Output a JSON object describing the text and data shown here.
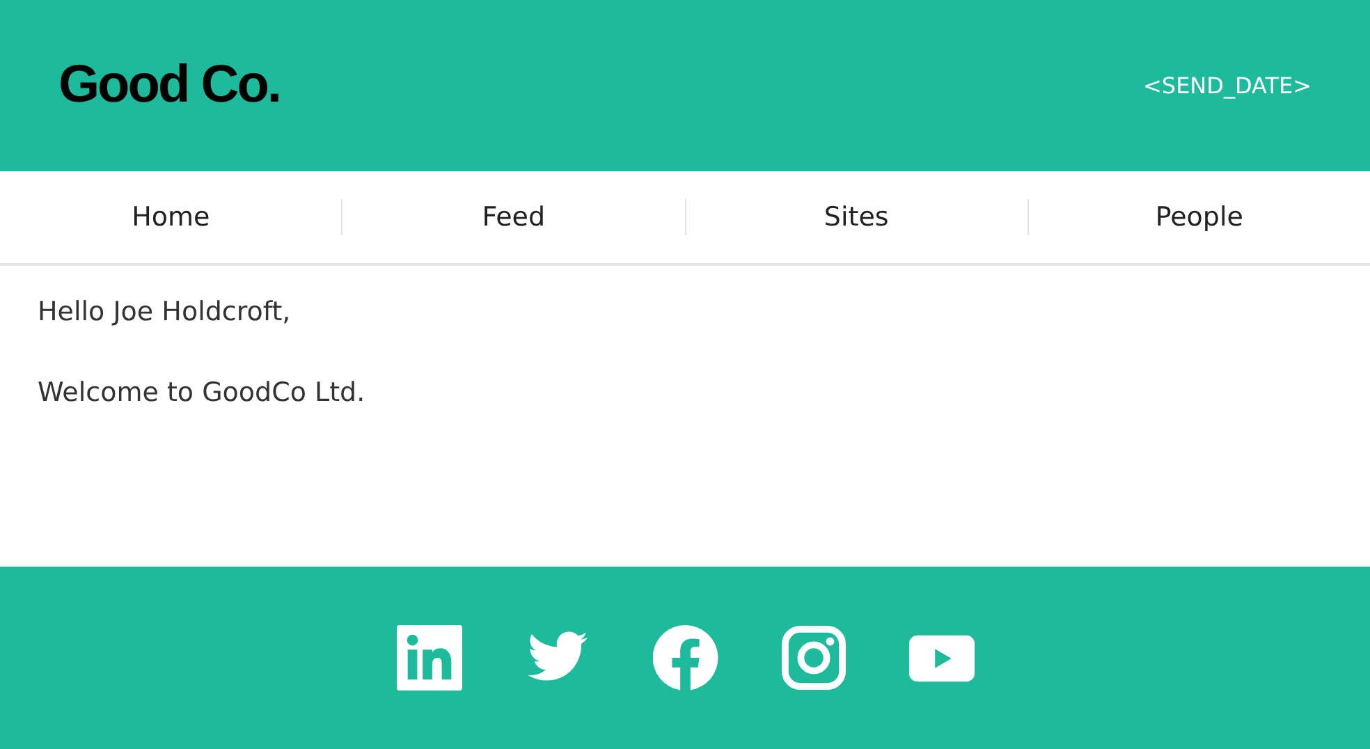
{
  "header": {
    "logo": "Good Co.",
    "send_date": "<SEND_DATE>"
  },
  "nav": [
    {
      "label": "Home"
    },
    {
      "label": "Feed"
    },
    {
      "label": "Sites"
    },
    {
      "label": "People"
    }
  ],
  "body": {
    "paragraphs": [
      "Hello Joe Holdcroft,",
      "Welcome to GoodCo Ltd."
    ]
  },
  "footer": {
    "social": [
      {
        "kind": "linkedin"
      },
      {
        "kind": "twitter"
      },
      {
        "kind": "facebook"
      },
      {
        "kind": "instagram"
      },
      {
        "kind": "youtube"
      }
    ]
  }
}
